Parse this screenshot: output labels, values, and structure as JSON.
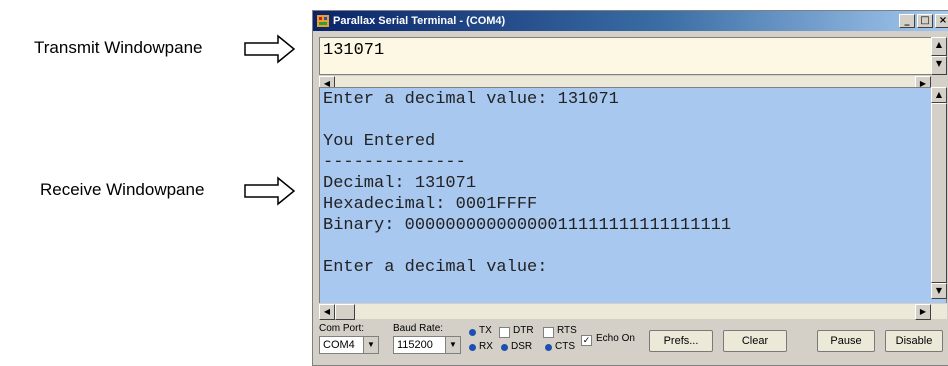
{
  "callouts": {
    "transmit_label": "Transmit Windowpane",
    "receive_label": "Receive Windowpane"
  },
  "window": {
    "title": "Parallax Serial Terminal - (COM4)",
    "minimize": "_",
    "maximize": "□",
    "close": "×"
  },
  "transmit": {
    "text": "131071"
  },
  "receive": {
    "lines": [
      "Enter a decimal value: 131071",
      "",
      "You Entered",
      "--------------",
      "Decimal: 131071",
      "Hexadecimal: 0001FFFF",
      "Binary: 00000000000000011111111111111111",
      "",
      "Enter a decimal value:"
    ]
  },
  "controls": {
    "com_port_label": "Com Port:",
    "com_port_value": "COM4",
    "baud_rate_label": "Baud Rate:",
    "baud_rate_value": "115200",
    "tx": "TX",
    "rx": "RX",
    "dtr": "DTR",
    "dsr": "DSR",
    "rts": "RTS",
    "cts": "CTS",
    "echo_on": "Echo On",
    "echo_checked": "✓",
    "prefs": "Prefs...",
    "clear": "Clear",
    "pause": "Pause",
    "disable": "Disable"
  },
  "colors": {
    "transmit_bg": "#fdf8e4",
    "receive_bg": "#a8c8f0",
    "led": "#1e4fb0"
  }
}
